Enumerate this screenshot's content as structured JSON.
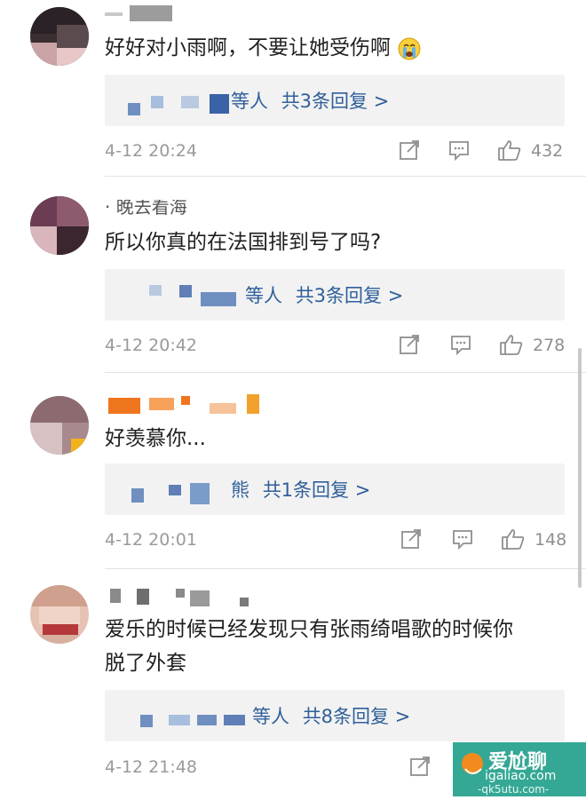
{
  "comments": [
    {
      "text": "好好对小雨啊，不要让她受伤啊",
      "emoji": "crying-face-emoji",
      "replies_who": "等人",
      "replies_total": "共3条回复 >",
      "time": "4-12 20:24",
      "likes": "432"
    },
    {
      "username_partial": "· 晚去看海",
      "text": "所以你真的在法国排到号了吗?",
      "replies_who": "等人",
      "replies_total": "共3条回复 >",
      "time": "4-12 20:42",
      "likes": "278"
    },
    {
      "text": "好羡慕你...",
      "replies_who": "熊",
      "replies_total": "共1条回复 >",
      "time": "4-12 20:01",
      "likes": "148"
    },
    {
      "text_line1": "爱乐的时候已经发现只有张雨绮唱歌的时候你",
      "text_line2": "脱了外套",
      "replies_who": "等人",
      "replies_total": "共8条回复 >",
      "time": "4-12 21:48"
    }
  ],
  "watermark": {
    "brand": "爱尬聊",
    "url": "igaliao.com",
    "sub": "-qk5utu.com-"
  },
  "icons": [
    "share-icon",
    "comment-icon",
    "like-icon"
  ],
  "colors": {
    "link": "#2f5f9a",
    "meta": "#9a9a9a",
    "reply_bg": "#f2f2f2"
  }
}
